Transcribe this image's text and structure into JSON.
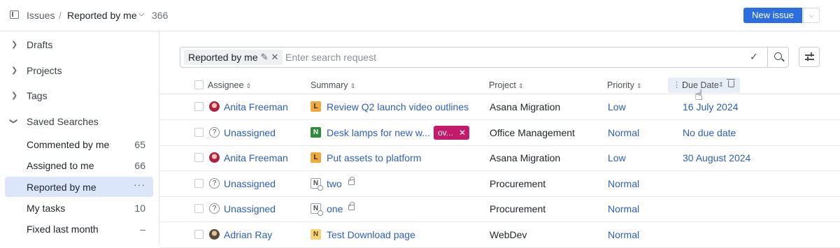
{
  "header": {
    "breadcrumb_root": "Issues",
    "breadcrumb_separator": "/",
    "current_view": "Reported by me",
    "count": "366",
    "new_issue_label": "New issue"
  },
  "sidebar": {
    "sections": [
      {
        "label": "Drafts",
        "expanded": false
      },
      {
        "label": "Projects",
        "expanded": false
      },
      {
        "label": "Tags",
        "expanded": false
      },
      {
        "label": "Saved Searches",
        "expanded": true
      }
    ],
    "saved_searches": [
      {
        "label": "Commented by me",
        "count": "65"
      },
      {
        "label": "Assigned to me",
        "count": "66"
      },
      {
        "label": "Reported by me",
        "count": "···",
        "active": true
      },
      {
        "label": "My tasks",
        "count": "10"
      },
      {
        "label": "Fixed last month",
        "count": "–"
      }
    ]
  },
  "search": {
    "chip_label": "Reported by me",
    "placeholder": "Enter search request"
  },
  "table": {
    "columns": [
      "Assignee",
      "Summary",
      "Project",
      "Priority",
      "Due Date"
    ],
    "rows": [
      {
        "assignee": "Anita Freeman",
        "avatar": "anita",
        "project_key": "L",
        "summary": "Review Q2 launch video outlines",
        "project": "Asana Migration",
        "priority": "Low",
        "due": "16 July 2024"
      },
      {
        "assignee": "Unassigned",
        "avatar": "unassigned",
        "project_key": "N",
        "summary": "Desk lamps for new w...",
        "tag": "ov...",
        "project": "Office Management",
        "priority": "Normal",
        "due": "No due date"
      },
      {
        "assignee": "Anita Freeman",
        "avatar": "anita",
        "project_key": "L",
        "summary": "Put assets to platform",
        "project": "Asana Migration",
        "priority": "Low",
        "due": "30 August 2024"
      },
      {
        "assignee": "Unassigned",
        "avatar": "unassigned",
        "project_key": "N",
        "summary": "two",
        "locked": true,
        "project": "Procurement",
        "priority": "Normal",
        "due": ""
      },
      {
        "assignee": "Unassigned",
        "avatar": "unassigned",
        "project_key": "N",
        "summary": "one",
        "locked": true,
        "project": "Procurement",
        "priority": "Normal",
        "due": ""
      },
      {
        "assignee": "Adrian Ray",
        "avatar": "adrian",
        "project_key": "N",
        "summary": "Test Download page",
        "project": "WebDev",
        "priority": "Normal",
        "due": ""
      }
    ]
  },
  "colors": {
    "accent": "#2c6de0",
    "link": "#2c5fb6",
    "active_item": "#dbe6fb",
    "tag": "#c51a6b"
  }
}
